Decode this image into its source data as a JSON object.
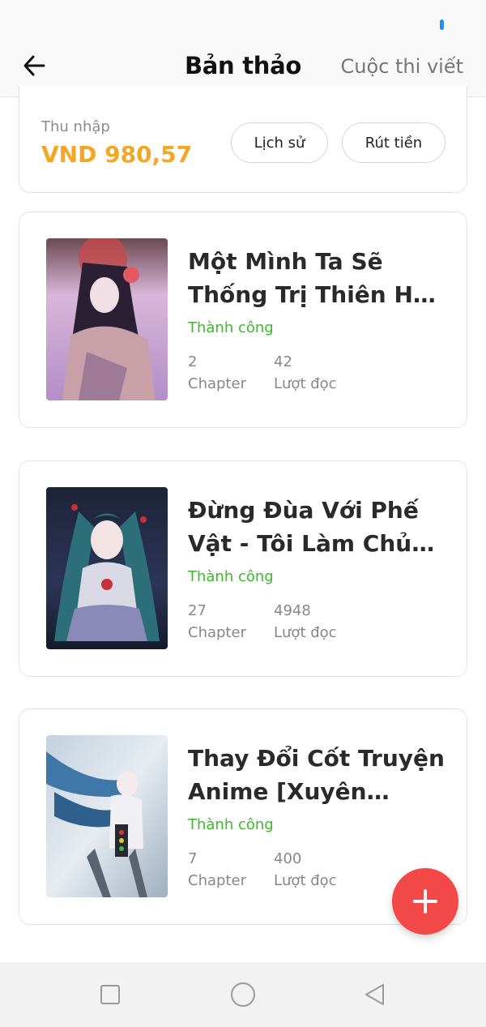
{
  "header": {
    "title": "Bản thảo",
    "contest_link": "Cuộc thi viết"
  },
  "income": {
    "label": "Thu nhập",
    "value": "VND 980,57",
    "history_label": "Lịch sử",
    "withdraw_label": "Rút tiền"
  },
  "stories": [
    {
      "title": "Một Mình Ta Sẽ Thống Trị Thiên Hạ: Hãy Ma...",
      "status": "Thành công",
      "chapters": "2",
      "chapters_label": "Chapter",
      "reads": "42",
      "reads_label": "Lượt đọc"
    },
    {
      "title": "Đừng Đùa Với Phế Vật - Tôi Làm Chủ T...",
      "status": "Thành công",
      "chapters": "27",
      "chapters_label": "Chapter",
      "reads": "4948",
      "reads_label": "Lượt đọc"
    },
    {
      "title": "Thay Đổi Cốt Truyện Anime [Xuyên Không]",
      "status": "Thành công",
      "chapters": "7",
      "chapters_label": "Chapter",
      "reads": "400",
      "reads_label": "Lượt đọc"
    }
  ],
  "icons": {
    "back": "arrow-left-icon",
    "add": "plus-icon",
    "nav_recent": "square-icon",
    "nav_home": "circle-icon",
    "nav_back": "triangle-back-icon"
  },
  "colors": {
    "income": "#f5a623",
    "status_success": "#3cba2c",
    "fab": "#f24848",
    "status_indicator": "#1e90ff"
  }
}
